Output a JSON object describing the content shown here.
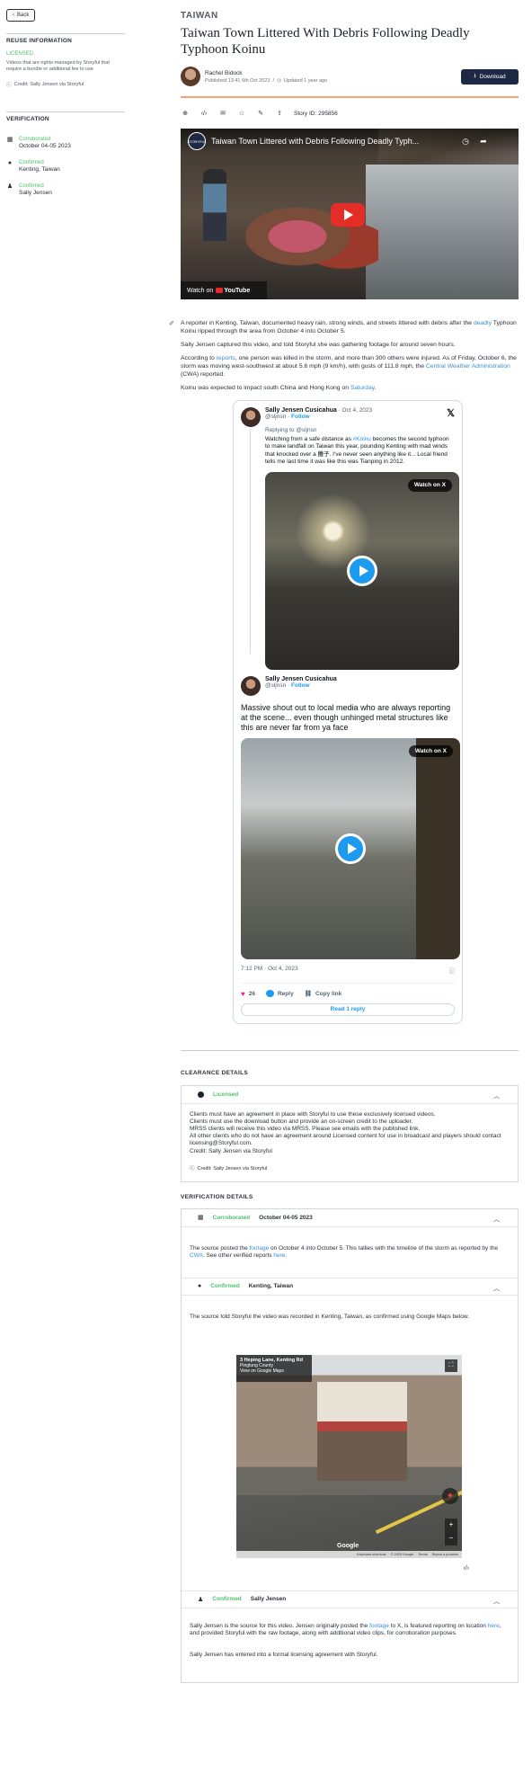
{
  "sidebar": {
    "back_label": "Back",
    "reuse_heading": "REUSE INFORMATION",
    "license_label": "LICENSED",
    "license_desc": "Videos that are rights-managed by Storyful that require a bundle or additional fee to use",
    "credit": "Credit: Sally Jensen via Storyful",
    "verification_heading": "VERIFICATION",
    "verification": [
      {
        "icon": "calendar-icon",
        "status": "Corroborated",
        "value": "October 04-05 2023"
      },
      {
        "icon": "location-pin-icon",
        "status": "Confirmed",
        "value": "Kenting, Taiwan"
      },
      {
        "icon": "person-icon",
        "status": "Confirmed",
        "value": "Sally Jensen"
      }
    ]
  },
  "story": {
    "kicker": "TAIWAN",
    "title": "Taiwan Town Littered With Debris Following Deadly Typhoon Koinu",
    "author": "Rachel Bidock",
    "published": "Published 13:41 6th Oct 2023",
    "separator": "/",
    "updated": "Updated 1 year ago",
    "download_label": "Download",
    "story_id": "Story ID: 295856",
    "toolbar_icons": [
      "add-icon",
      "embed-code-icon",
      "email-icon",
      "star-icon",
      "edit-icon",
      "share-icon"
    ]
  },
  "video": {
    "channel": "STORYFUL",
    "title": "Taiwan Town Littered with Debris Following Deadly Typh...",
    "watch_on": "Watch on",
    "youtube": "YouTube"
  },
  "article": {
    "p1_a": "A reporter in Kenting, Taiwan, documented heavy rain, strong winds, and streets littered with debris after the ",
    "p1_link": "deadly",
    "p1_b": " Typhoon Koinu ripped through the area from October 4 into October 5.",
    "p2": "Sally Jensen captured this video, and told Storyful she was gathering footage for around seven hours.",
    "p3_a": "According to ",
    "p3_link1": "reports",
    "p3_b": ", one person was killed in the storm, and more than 300 others were injured. As of Friday, October 6, the storm was moving west-southwest at about 5.6 mph (9 km/h), with gusts of 111.8 mph, the ",
    "p3_link2": "Central Weather Administration",
    "p3_c": " (CWA) reported.",
    "p4_a": "Koinu was expected to impact south China and Hong Kong on ",
    "p4_link": "Saturday",
    "p4_b": "."
  },
  "tweet": {
    "name": "Sally Jensen Cusicahua",
    "date": "· Oct 4, 2023",
    "handle": "@sljnsn",
    "follow": "Follow",
    "replying_to": "Replying to @sljnsn",
    "text1_a": "Watching from a safe distance as ",
    "text1_hashtag": "#Koinu",
    "text1_b": " becomes the second typhoon to make landfall on Taiwan this year, pounding Kenting with mad winds that knocked over a 攤子. I've never seen anything like it... Local friend tells me last time it was like this was Tianping in 2012.",
    "watch_on_x": "Watch on X",
    "name2": "Sally Jensen Cusicahua",
    "handle2": "@sljnsn",
    "follow2": "Follow",
    "text2": "Massive shout out to local media who are always reporting at the scene... even though unhinged metal structures like this are never far from ya face",
    "timestamp": "7:12 PM · Oct 4, 2023",
    "likes": "26",
    "reply": "Reply",
    "copy_link": "Copy link",
    "read_reply": "Read 1 reply"
  },
  "clearance": {
    "heading": "CLEARANCE DETAILS",
    "status": "Licensed",
    "lines": [
      "Videos that are rights-managed by Storyful that require a bundle or additional fee to use",
      "Clients must have an agreement in place with Storyful to use these exclusively licensed videos.",
      "Clients must use the download button and provide an on-screen credit to the uploader.",
      "MRSS clients will receive this video via MRSS. Please see emails with the published link.",
      "All other clients who do not have an agreement around Licensed content for use in broadcast and players should contact licensing@Storyful.com.",
      "Credit: Sally Jensen via Storyful"
    ],
    "credit": "Credit: Sally Jensen via Storyful"
  },
  "verification": {
    "heading": "VERIFICATION DETAILS",
    "date": {
      "status": "Corroborated",
      "value": "October 04-05 2023",
      "text_a": "The source posted the ",
      "link1": "footage",
      "text_b": " on October 4 into October 5. This tallies with the timeline of the storm as reported by the ",
      "link2": "CWA",
      "text_c": ". See other verified reports ",
      "link3": "here",
      "text_d": "."
    },
    "location": {
      "status": "Confirmed",
      "value": "Kenting, Taiwan",
      "text": "The source told Storyful the video was recorded in Kenting, Taiwan, as confirmed using Google Maps below.",
      "map_title": "3 Heping Lane, Kenting Rd",
      "map_sub": "Pingtung County",
      "map_link": "View on Google Maps",
      "map_google": "Google",
      "map_footer": [
        "Keyboard shortcuts",
        "© 2023 Google",
        "Terms",
        "Report a problem"
      ]
    },
    "source": {
      "status": "Confirmed",
      "value": "Sally Jensen",
      "text_a": "Sally Jensen is the source for this video. Jensen originally posted the ",
      "link1": "footage",
      "text_b": " to X, is featured reporting on location ",
      "link2": "here",
      "text_c": ", and provided Storyful with the raw footage, along with additional video clips, for corroboration purposes.",
      "agreement": "Sally Jensen has entered into a formal licensing agreement with Storyful."
    }
  },
  "colors": {
    "accent_green": "#4fc26d",
    "link_blue": "#3b8fd6",
    "download_navy": "#1d2845",
    "divider_orange": "#f2a47a",
    "x_blue": "#1d9bf0"
  }
}
